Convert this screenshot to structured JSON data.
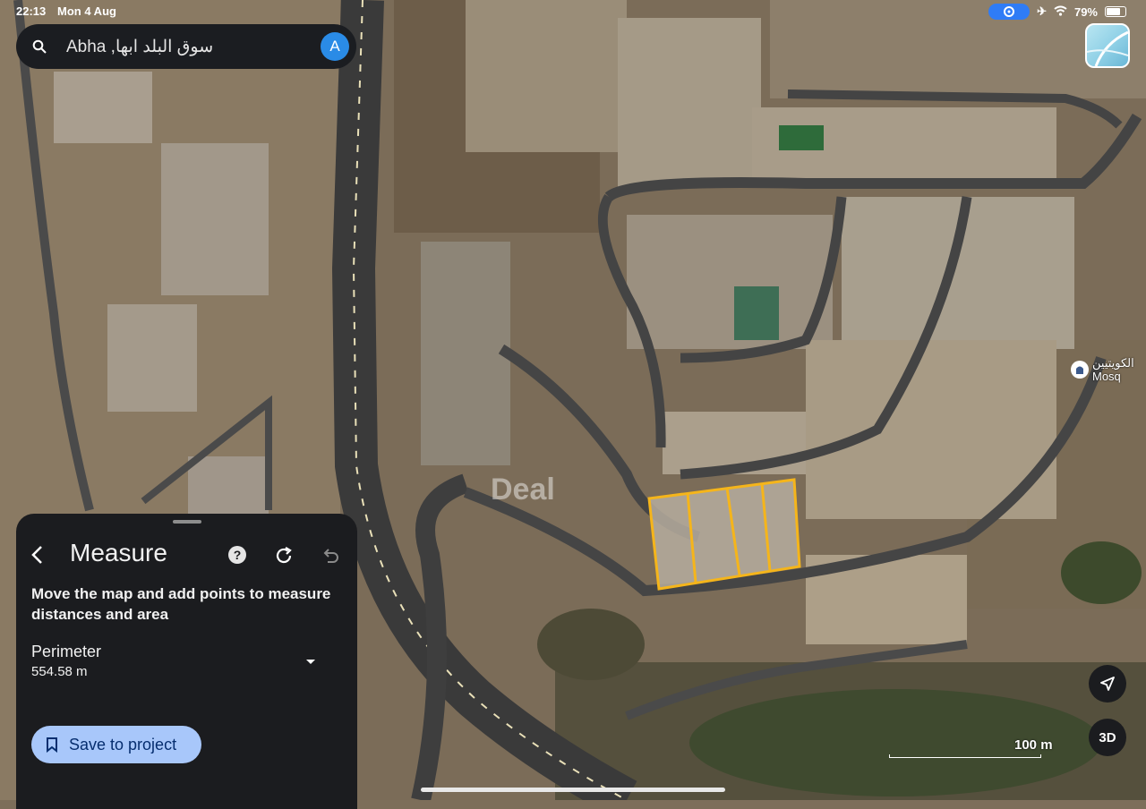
{
  "status_bar": {
    "time": "22:13",
    "date": "Mon 4 Aug",
    "battery": "79%"
  },
  "search": {
    "query": "Abha ,سوق البلد ابها",
    "avatar_letter": "A"
  },
  "map": {
    "type": "satellite",
    "poi": {
      "name": "الكويتيين",
      "subtitle": "Mosq"
    },
    "watermark": "Deal",
    "scale_label": "100 m",
    "colors": {
      "measure_outline": "#f5b51b",
      "accent": "#a8c7fa"
    }
  },
  "panel": {
    "title": "Measure",
    "instructions": "Move the map and add points to measure distances and area",
    "metric_label": "Perimeter",
    "metric_value": "554.58 m",
    "save_label": "Save to project",
    "icons": [
      "chevron-left-icon",
      "help-icon",
      "refresh-icon",
      "undo-icon",
      "chevron-down-icon",
      "bookmark-icon"
    ]
  },
  "controls": {
    "threed_label": "3D"
  }
}
